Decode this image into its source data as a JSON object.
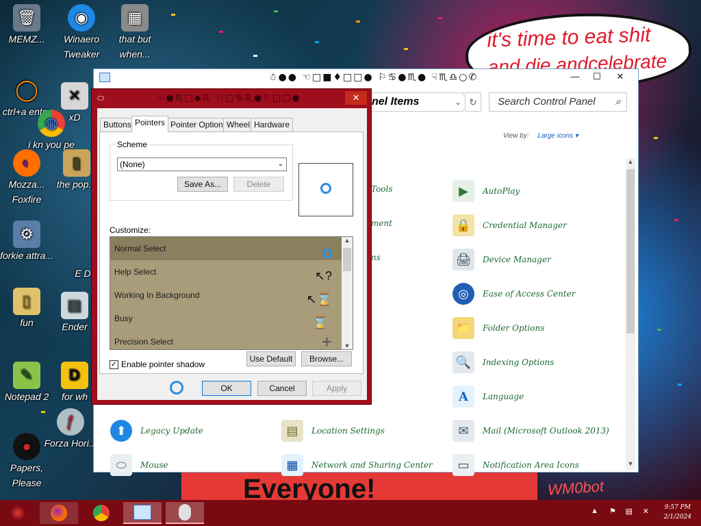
{
  "desktop": {
    "bubble": {
      "line1": "it's time to eat shit",
      "line2": "and die andcelebrate"
    },
    "banner": "Everyone!",
    "watermark": "WM0bot",
    "icons": [
      {
        "label": "MEMZ...",
        "glyph": "🗑"
      },
      {
        "label": "Winaero Tweaker",
        "glyph": "◉"
      },
      {
        "label": "that but when...",
        "glyph": "▦"
      },
      {
        "label": "ctrl+a enter",
        "glyph": "◯"
      },
      {
        "label": "xD",
        "glyph": "✕"
      },
      {
        "label": "i kn you pe",
        "glyph": "◍"
      },
      {
        "label": "Mozza... Foxfire",
        "glyph": "◐"
      },
      {
        "label": "the pop...",
        "glyph": "▮"
      },
      {
        "label": "forkie attra...",
        "glyph": "⚙"
      },
      {
        "label": "E D",
        "glyph": ""
      },
      {
        "label": "fun",
        "glyph": "▯"
      },
      {
        "label": "Ender",
        "glyph": "▤"
      },
      {
        "label": "Notepad 2",
        "glyph": "✎"
      },
      {
        "label": "for wh",
        "glyph": "D"
      },
      {
        "label": "Forza Hori...",
        "glyph": "ƒ"
      },
      {
        "label": "Papers, Please",
        "glyph": "●"
      }
    ]
  },
  "control_panel": {
    "title": "☃●● ☜□■♦□□● ⚐♋●♏● ☟♏♎○✆",
    "address": "nel Items",
    "search_placeholder": "Search Control Panel",
    "view_by_label": "View by:",
    "view_by_value": "Large icons",
    "items": [
      {
        "label": "Tools",
        "glyph": ""
      },
      {
        "label": "AutoPlay",
        "glyph": "▶"
      },
      {
        "label": "ment",
        "glyph": ""
      },
      {
        "label": "Credential Manager",
        "glyph": "🔒"
      },
      {
        "label": "ns",
        "glyph": ""
      },
      {
        "label": "Device Manager",
        "glyph": "🖨"
      },
      {
        "label": "Ease of Access Center",
        "glyph": "◎"
      },
      {
        "label": "Folder Options",
        "glyph": "📁"
      },
      {
        "label": "Indexing Options",
        "glyph": "🔍"
      },
      {
        "label": "Language",
        "glyph": "A"
      },
      {
        "label": "Legacy Update",
        "glyph": "⬆"
      },
      {
        "label": "Location Settings",
        "glyph": "▤"
      },
      {
        "label": "Mail (Microsoft Outlook 2013)",
        "glyph": "✉"
      },
      {
        "label": "Mouse",
        "glyph": "⬭"
      },
      {
        "label": "Network and Sharing Center",
        "glyph": "▦"
      },
      {
        "label": "Notification Area Icons",
        "glyph": "▭"
      }
    ]
  },
  "mouse_dialog": {
    "title": "☜●♏□◆♏ ⚐□♋♏●⚐□□●",
    "close_glyph": "✕",
    "tabs": [
      "Buttons",
      "Pointers",
      "Pointer Options",
      "Wheel",
      "Hardware"
    ],
    "active_tab": "Pointers",
    "scheme_label": "Scheme",
    "scheme_value": "(None)",
    "save_as": "Save As...",
    "delete": "Delete",
    "customize_label": "Customize:",
    "pointers": [
      {
        "name": "Normal Select",
        "cursor": "◌"
      },
      {
        "name": "Help Select",
        "cursor": "↖?"
      },
      {
        "name": "Working In Background",
        "cursor": "↖⌛"
      },
      {
        "name": "Busy",
        "cursor": "⌛"
      },
      {
        "name": "Precision Select",
        "cursor": "+"
      }
    ],
    "shadow_label": "Enable pointer shadow",
    "shadow_checked": true,
    "use_default": "Use Default",
    "browse": "Browse...",
    "ok": "OK",
    "cancel": "Cancel",
    "apply": "Apply"
  },
  "taskbar": {
    "clock_time": "9:57 PM",
    "clock_date": "2/1/2024"
  }
}
